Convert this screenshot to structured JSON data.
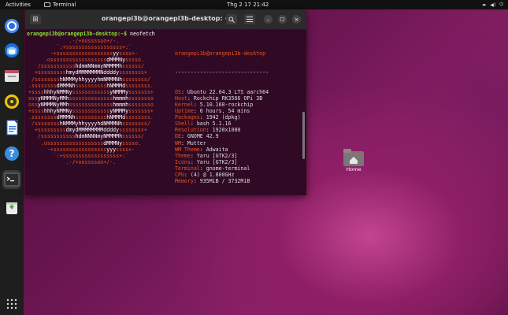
{
  "topbar": {
    "activities": "Activities",
    "app_name": "Terminal",
    "clock": "Thg 2 17  21:42"
  },
  "dock": {
    "items": [
      "chromium",
      "thunderbird",
      "files",
      "rhythmbox",
      "libreoffice-writer",
      "help",
      "terminal",
      "trash"
    ]
  },
  "terminal": {
    "title": "orangepi3b@orangepi3b-desktop: ~",
    "prompt": "orangepi3b@orangepi3b-desktop:~$",
    "command": " neofetch",
    "user_host": "orangepi3b@orangepi3b-desktop",
    "separator": "------------------------------",
    "info": [
      {
        "key": "OS",
        "value": "Ubuntu 22.04.3 LTS aarch64"
      },
      {
        "key": "Host",
        "value": "Rockchip RK3566 OPi 3B"
      },
      {
        "key": "Kernel",
        "value": "5.10.160-rockchip"
      },
      {
        "key": "Uptime",
        "value": "6 hours, 54 mins"
      },
      {
        "key": "Packages",
        "value": "1942 (dpkg)"
      },
      {
        "key": "Shell",
        "value": "bash 5.1.16"
      },
      {
        "key": "Resolution",
        "value": "1920x1080"
      },
      {
        "key": "DE",
        "value": "GNOME 42.9"
      },
      {
        "key": "WM",
        "value": "Mutter"
      },
      {
        "key": "WM Theme",
        "value": "Adwaita"
      },
      {
        "key": "Theme",
        "value": "Yaru [GTK2/3]"
      },
      {
        "key": "Icons",
        "value": "Yaru [GTK2/3]"
      },
      {
        "key": "Terminal",
        "value": "gnome-terminal"
      },
      {
        "key": "CPU",
        "value": "(4) @ 1.800GHz"
      },
      {
        "key": "Memory",
        "value": "935MiB / 3732MiB"
      }
    ],
    "palette_top": [
      "#2e3436",
      "#cc0000",
      "#4e9a06",
      "#c4a000",
      "#3465a4",
      "#75507b",
      "#06989a",
      "#d3d7cf"
    ],
    "palette_bottom": [
      "#555753",
      "#ef2929",
      "#8ae234",
      "#fce94f",
      "#729fcf",
      "#ad7fa8",
      "#34e2e2",
      "#eeeeec"
    ],
    "logo_lines": [
      "             .-/+oossssoo+/-.",
      "         `:+ssssssssssssssssss+:`",
      "       -+ssssssssssssssssssyyssss+-",
      "     .ossssssssssssssssssdMMMNysssso.",
      "   /ssssssssssshdmmNNmmyNMMMMhssssss/",
      "  +ssssssssshmydMMMMMMMNddddyssssssss+",
      " /sssssssshNMMMyhhyyyyhmNMMMNhssssssss/",
      ".ssssssssdMMMNhsssssssssshNMMMdssssssss.",
      "+sssshhhyNMMNyssssssssssssyNMMMysssssss+",
      "ossyNMMMNyMMhsssssssssssssshmmmhssssssso",
      "ossyNMMMNyMMhsssssssssssssshmmmhssssssso",
      "+sssshhhyNMMNyssssssssssssyNMMMysssssss+",
      ".ssssssssdMMMNhsssssssssshNMMMdssssssss.",
      " /sssssssshNMMMyhhyyyyhdNMMMNhssssssss/",
      "  +sssssssssdmydMMMMMMMMddddyssssssss+",
      "   /ssssssssssshdmNNNNmyNMMMMhssssss/",
      "    .ossssssssssssssssssdMMMNysssso.",
      "      -+sssssssssssssssssyyyssss+-",
      "        `:+ssssssssssssssssss+:`",
      "            .-/+oossssoo+/-."
    ]
  }
}
